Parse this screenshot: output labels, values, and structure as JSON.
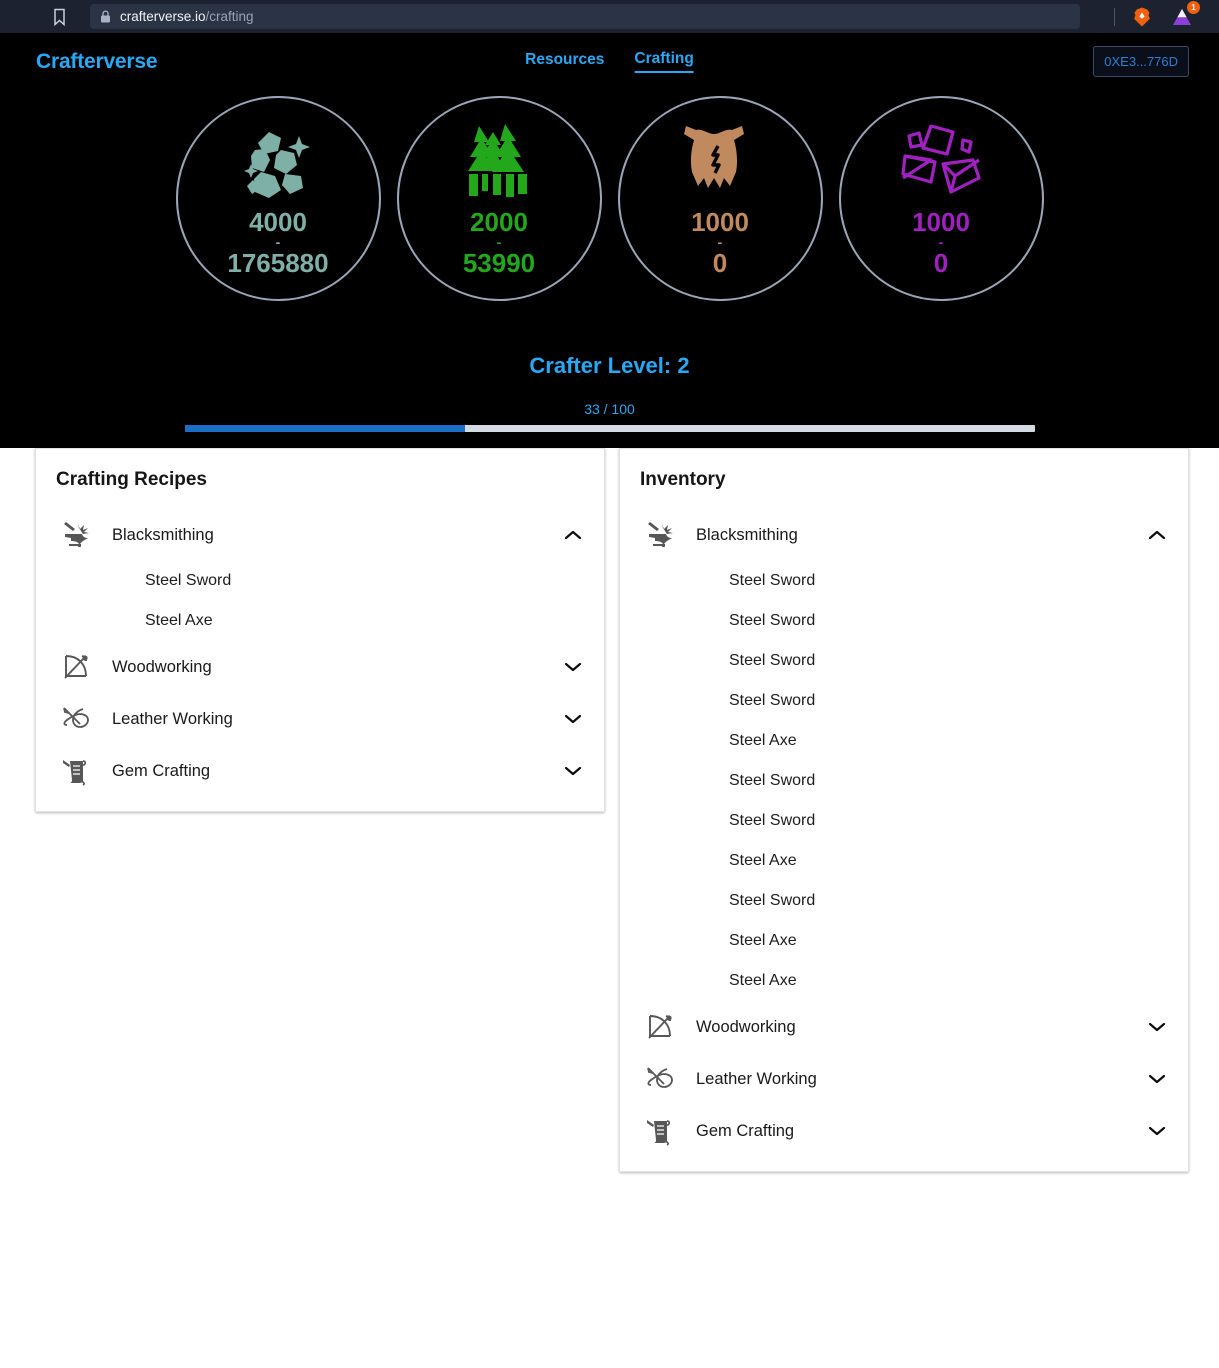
{
  "browser": {
    "bookmark_icon": "bookmark-icon",
    "lock_icon": "lock-icon",
    "url_domain": "crafterverse.io",
    "url_path": "/crafting",
    "brave_icon": "brave-lion-icon",
    "extension_icon": "triangle-extension-icon",
    "extension_badge": "1"
  },
  "header": {
    "brand": "Crafterverse",
    "nav": [
      {
        "label": "Resources",
        "active": false
      },
      {
        "label": "Crafting",
        "active": true
      }
    ],
    "wallet": "0XE3...776D",
    "accent_color": "#29a9f5"
  },
  "resources": [
    {
      "icon": "ore-rocks-icon",
      "amount": "4000",
      "separator": "-",
      "total": "1765880",
      "color": "#7fb0a8"
    },
    {
      "icon": "forest-trees-icon",
      "amount": "2000",
      "separator": "-",
      "total": "53990",
      "color": "#23a81c"
    },
    {
      "icon": "animal-hide-icon",
      "amount": "1000",
      "separator": "-",
      "total": "0",
      "color": "#c08a5e"
    },
    {
      "icon": "gems-icon",
      "amount": "1000",
      "separator": "-",
      "total": "0",
      "color": "#a020c0"
    }
  ],
  "level": {
    "title": "Crafter Level: 2",
    "xp_text": "33 / 100",
    "progress_percent": 33,
    "bar_color": "#1b6fc4",
    "track_color": "#d3dae3"
  },
  "recipes_panel": {
    "title": "Crafting Recipes",
    "categories": [
      {
        "label": "Blacksmithing",
        "icon": "anvil-icon",
        "expanded": true,
        "chevron": "chevron-up-icon",
        "items": [
          "Steel Sword",
          "Steel Axe"
        ]
      },
      {
        "label": "Woodworking",
        "icon": "bow-and-arrow-icon",
        "expanded": false,
        "chevron": "chevron-down-icon",
        "items": []
      },
      {
        "label": "Leather Working",
        "icon": "needle-and-thread-icon",
        "expanded": false,
        "chevron": "chevron-down-icon",
        "items": []
      },
      {
        "label": "Gem Crafting",
        "icon": "gem-scroll-icon",
        "expanded": false,
        "chevron": "chevron-down-icon",
        "items": []
      }
    ]
  },
  "inventory_panel": {
    "title": "Inventory",
    "categories": [
      {
        "label": "Blacksmithing",
        "icon": "anvil-icon",
        "expanded": true,
        "chevron": "chevron-up-icon",
        "items": [
          "Steel Sword",
          "Steel Sword",
          "Steel Sword",
          "Steel Sword",
          "Steel Axe",
          "Steel Sword",
          "Steel Sword",
          "Steel Axe",
          "Steel Sword",
          "Steel Axe",
          "Steel Axe"
        ]
      },
      {
        "label": "Woodworking",
        "icon": "bow-and-arrow-icon",
        "expanded": false,
        "chevron": "chevron-down-icon",
        "items": []
      },
      {
        "label": "Leather Working",
        "icon": "needle-and-thread-icon",
        "expanded": false,
        "chevron": "chevron-down-icon",
        "items": []
      },
      {
        "label": "Gem Crafting",
        "icon": "gem-scroll-icon",
        "expanded": false,
        "chevron": "chevron-down-icon",
        "items": []
      }
    ]
  }
}
